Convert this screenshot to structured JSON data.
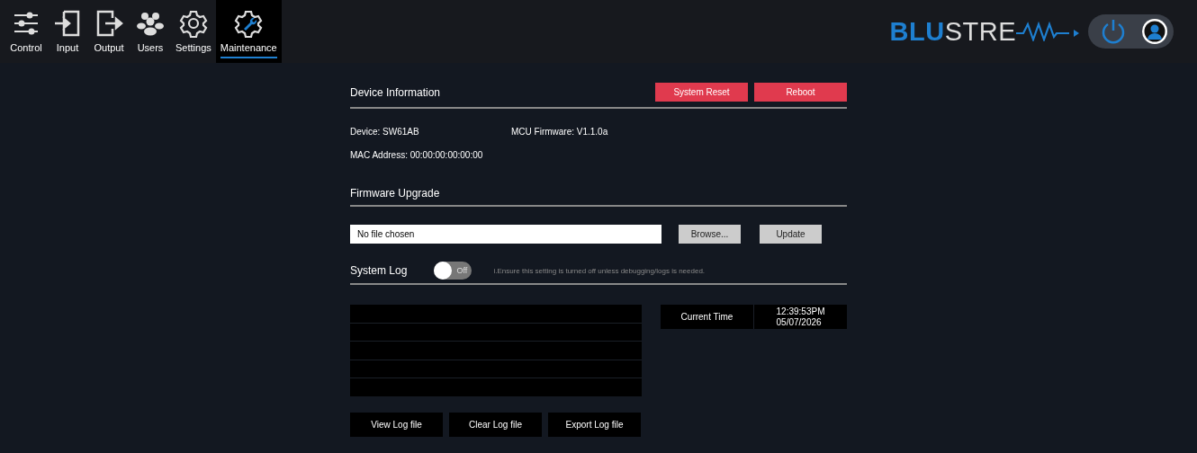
{
  "nav": [
    {
      "label": "Control",
      "selected": false
    },
    {
      "label": "Input",
      "selected": false
    },
    {
      "label": "Output",
      "selected": false
    },
    {
      "label": "Users",
      "selected": false
    },
    {
      "label": "Settings",
      "selected": false
    },
    {
      "label": "Maintenance",
      "selected": true
    }
  ],
  "logo": {
    "bold_part": "BLU",
    "rest": "STRE"
  },
  "device_information": {
    "title": "Device Information",
    "buttons": [
      "System Reset",
      "Reboot"
    ],
    "device": "Device: SW61AB",
    "firmware": "MCU Firmware: V1.1.0a",
    "mac": "MAC Address: 00:00:00:00:00:00"
  },
  "firmware_upgrade": {
    "title": "Firmware Upgrade",
    "file_field": {
      "value": "No file chosen"
    },
    "browse_button": "Browse...",
    "update_button": "Update"
  },
  "system_log": {
    "title": "System Log",
    "toggle": {
      "on": false,
      "label": "Off"
    },
    "hint": "i.Ensure this setting is turned off unless debugging/logs is needed.",
    "current_time": {
      "label": "Current Time",
      "time": "12:39:53PM",
      "date": "05/07/2026"
    },
    "buttons": [
      "View Log file",
      "Clear Log file",
      "Export Log file"
    ]
  }
}
